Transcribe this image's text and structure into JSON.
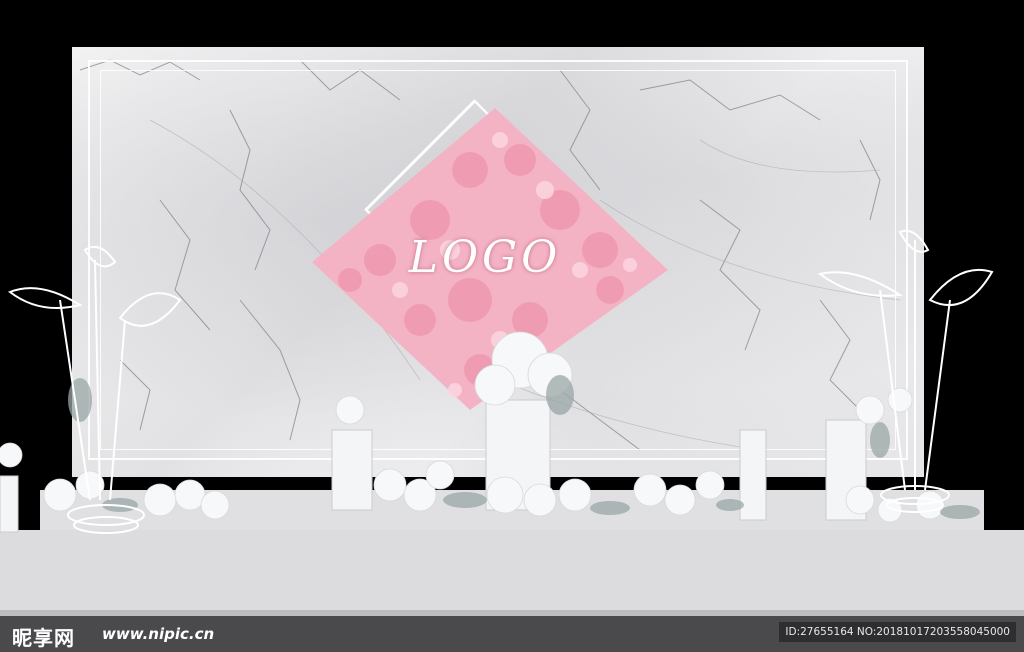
{
  "logo": {
    "text": "LOGO"
  },
  "watermark": {
    "site_logo": "昵享网",
    "site_url": "www.nipic.cn",
    "image_id": "ID:27655164 NO:20181017203558045000"
  },
  "colors": {
    "background": "#000000",
    "marble": "#ececee",
    "blossom": "#f2a9bd",
    "stage": "#dcdcde",
    "foliage": "#9aa7a6"
  }
}
